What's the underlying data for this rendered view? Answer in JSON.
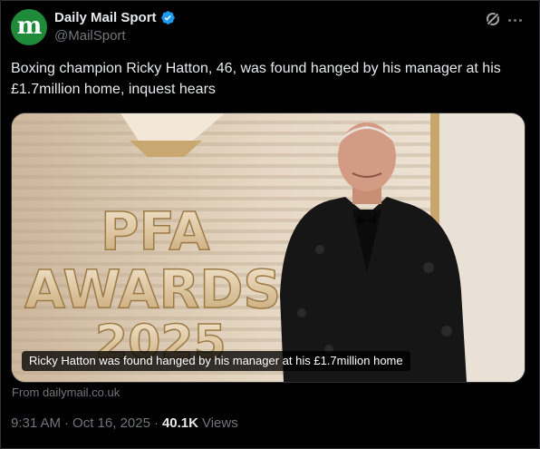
{
  "author": {
    "display_name": "Daily Mail Sport",
    "handle": "@MailSport",
    "avatar_letter": "m",
    "avatar_color": "#1f8a3a",
    "verified_color": "#1d9bf0"
  },
  "header_icons": [
    "grok-icon",
    "more-icon"
  ],
  "tweet": {
    "text": "Boxing champion Ricky Hatton, 46, was found hanged by his manager at his £1.7million home, inquest hears"
  },
  "media": {
    "sign_lines": [
      "PFA",
      "AWARDS",
      "2025"
    ],
    "caption": "Ricky Hatton was found hanged by his manager at his £1.7million home"
  },
  "source": {
    "text": "From dailymail.co.uk"
  },
  "meta": {
    "time": "9:31 AM",
    "separator": "·",
    "date": "Oct 16, 2025",
    "views_count": "40.1K",
    "views_label": "Views"
  },
  "colors": {
    "background": "#000000",
    "text_primary": "#e7e9ea",
    "text_secondary": "#71767b",
    "border": "#2f3336"
  }
}
